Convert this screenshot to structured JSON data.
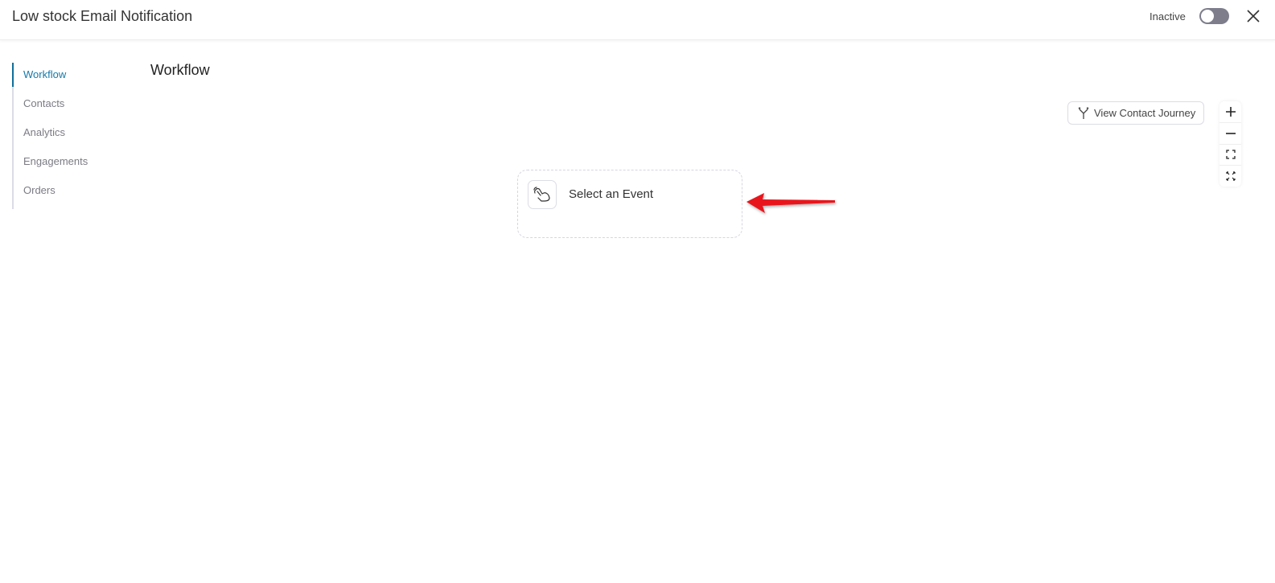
{
  "header": {
    "title": "Low stock Email Notification",
    "status_label": "Inactive",
    "toggle_on": false
  },
  "sidebar": {
    "items": [
      {
        "label": "Workflow",
        "active": true
      },
      {
        "label": "Contacts",
        "active": false
      },
      {
        "label": "Analytics",
        "active": false
      },
      {
        "label": "Engagements",
        "active": false
      },
      {
        "label": "Orders",
        "active": false
      }
    ]
  },
  "main": {
    "title": "Workflow",
    "view_journey_label": "View Contact Journey",
    "event_node_label": "Select an Event",
    "colors": {
      "accent": "#1479a8",
      "annotation_arrow": "#e8141b"
    }
  }
}
